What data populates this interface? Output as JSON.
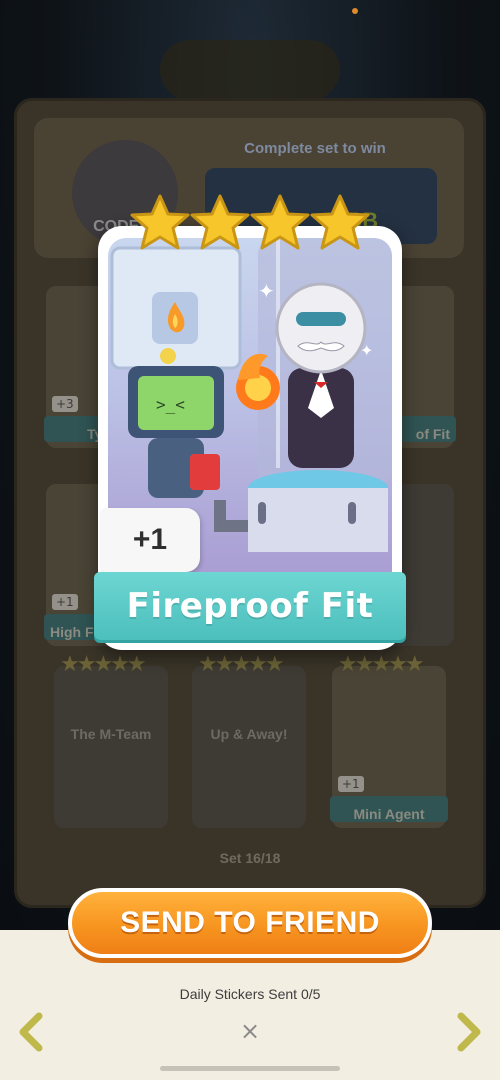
{
  "album": {
    "complete_text": "Complete set to win",
    "header_reward": "9B",
    "header_badge_label": "CODEN",
    "set_counter": "Set 16/18",
    "slots": [
      {
        "label": "Tyco",
        "plus": "+3"
      },
      {
        "label": "of Fit"
      },
      {
        "label": "High F",
        "plus": "+1"
      },
      {
        "label": "The M-Team"
      },
      {
        "label": "Up & Away!"
      },
      {
        "label": "Mini Agent",
        "plus": "+1"
      }
    ]
  },
  "card": {
    "name": "Fireproof Fit",
    "count_badge": "+1",
    "stars": 4,
    "colors": {
      "banner": "#5fcbc8",
      "star": "#f7c62a"
    }
  },
  "actions": {
    "send_label": "SEND TO FRIEND",
    "daily_sent": "Daily Stickers Sent 0/5",
    "close_label": "×"
  },
  "icons": {
    "prev": "chevron-left-icon",
    "next": "chevron-right-icon",
    "close": "close-icon"
  }
}
